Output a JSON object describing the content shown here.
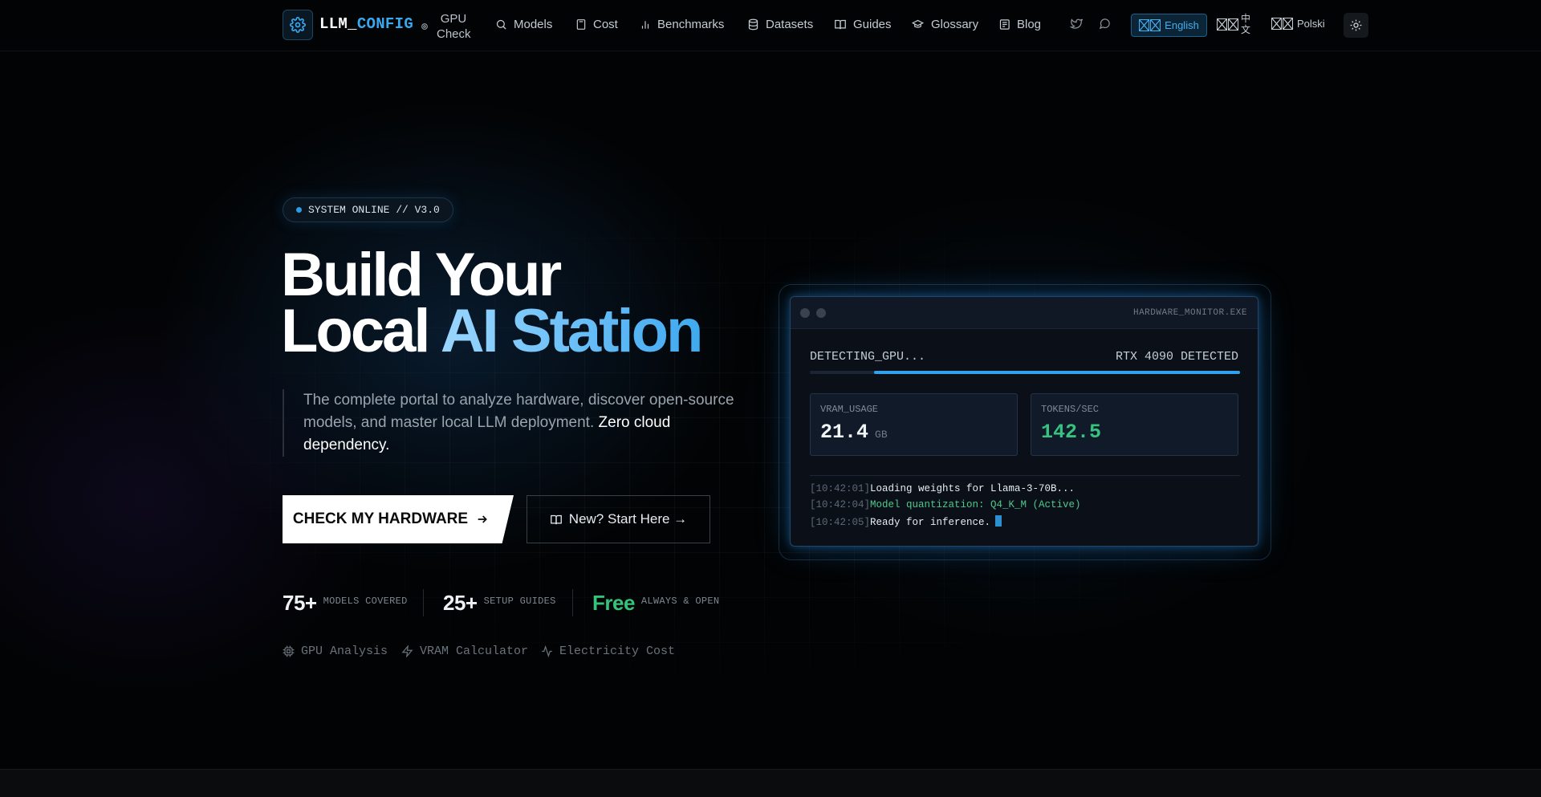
{
  "brand": {
    "logo_main": "LLM_",
    "logo_accent": "CONFIG"
  },
  "nav": {
    "gpu_check": "GPU Check",
    "items": [
      {
        "label": "Models",
        "icon": "search-icon"
      },
      {
        "label": "Cost",
        "icon": "calculator-icon"
      },
      {
        "label": "Benchmarks",
        "icon": "bar-chart-icon"
      },
      {
        "label": "Datasets",
        "icon": "database-icon"
      },
      {
        "label": "Guides",
        "icon": "book-icon"
      },
      {
        "label": "Glossary",
        "icon": "graduation-cap-icon"
      },
      {
        "label": "Blog",
        "icon": "newspaper-icon"
      }
    ],
    "languages": {
      "en": "English",
      "zh": "中文",
      "pl": "Polski"
    }
  },
  "hero": {
    "badge": "SYSTEM ONLINE // V3.0",
    "title_line1": "Build Your",
    "title_line2_plain": "Local ",
    "title_line2_accent": "AI Station",
    "description": "The complete portal to analyze hardware, discover open-source models, and master local LLM deployment. ",
    "description_strong": "Zero cloud dependency.",
    "cta_primary": "CHECK MY HARDWARE",
    "cta_secondary": "New? Start Here →",
    "stats": [
      {
        "value": "75+",
        "label": "MODELS COVERED"
      },
      {
        "value": "25+",
        "label": "SETUP GUIDES"
      },
      {
        "value": "Free",
        "label": "ALWAYS & OPEN"
      }
    ],
    "features": [
      "GPU Analysis",
      "VRAM Calculator",
      "Electricity Cost"
    ]
  },
  "monitor": {
    "window_title": "HARDWARE_MONITOR.EXE",
    "detecting_label": "DETECTING_GPU...",
    "detected_value": "RTX 4090 DETECTED",
    "progress_start": 0.15,
    "progress_end": 1.0,
    "vram_label": "VRAM_USAGE",
    "vram_value": "21.4",
    "vram_unit": "GB",
    "tokens_label": "TOKENS/SEC",
    "tokens_value": "142.5",
    "logs": [
      {
        "time": "[10:42:01]",
        "text": "Loading weights for Llama-3-70B..."
      },
      {
        "time": "[10:42:04]",
        "text": "Model quantization: Q4_K_M (Active)"
      },
      {
        "time": "[10:42:05]",
        "text": "Ready for inference."
      }
    ]
  },
  "colors": {
    "accent": "#38a9f0",
    "green": "#35c27a",
    "background": "#020304"
  }
}
